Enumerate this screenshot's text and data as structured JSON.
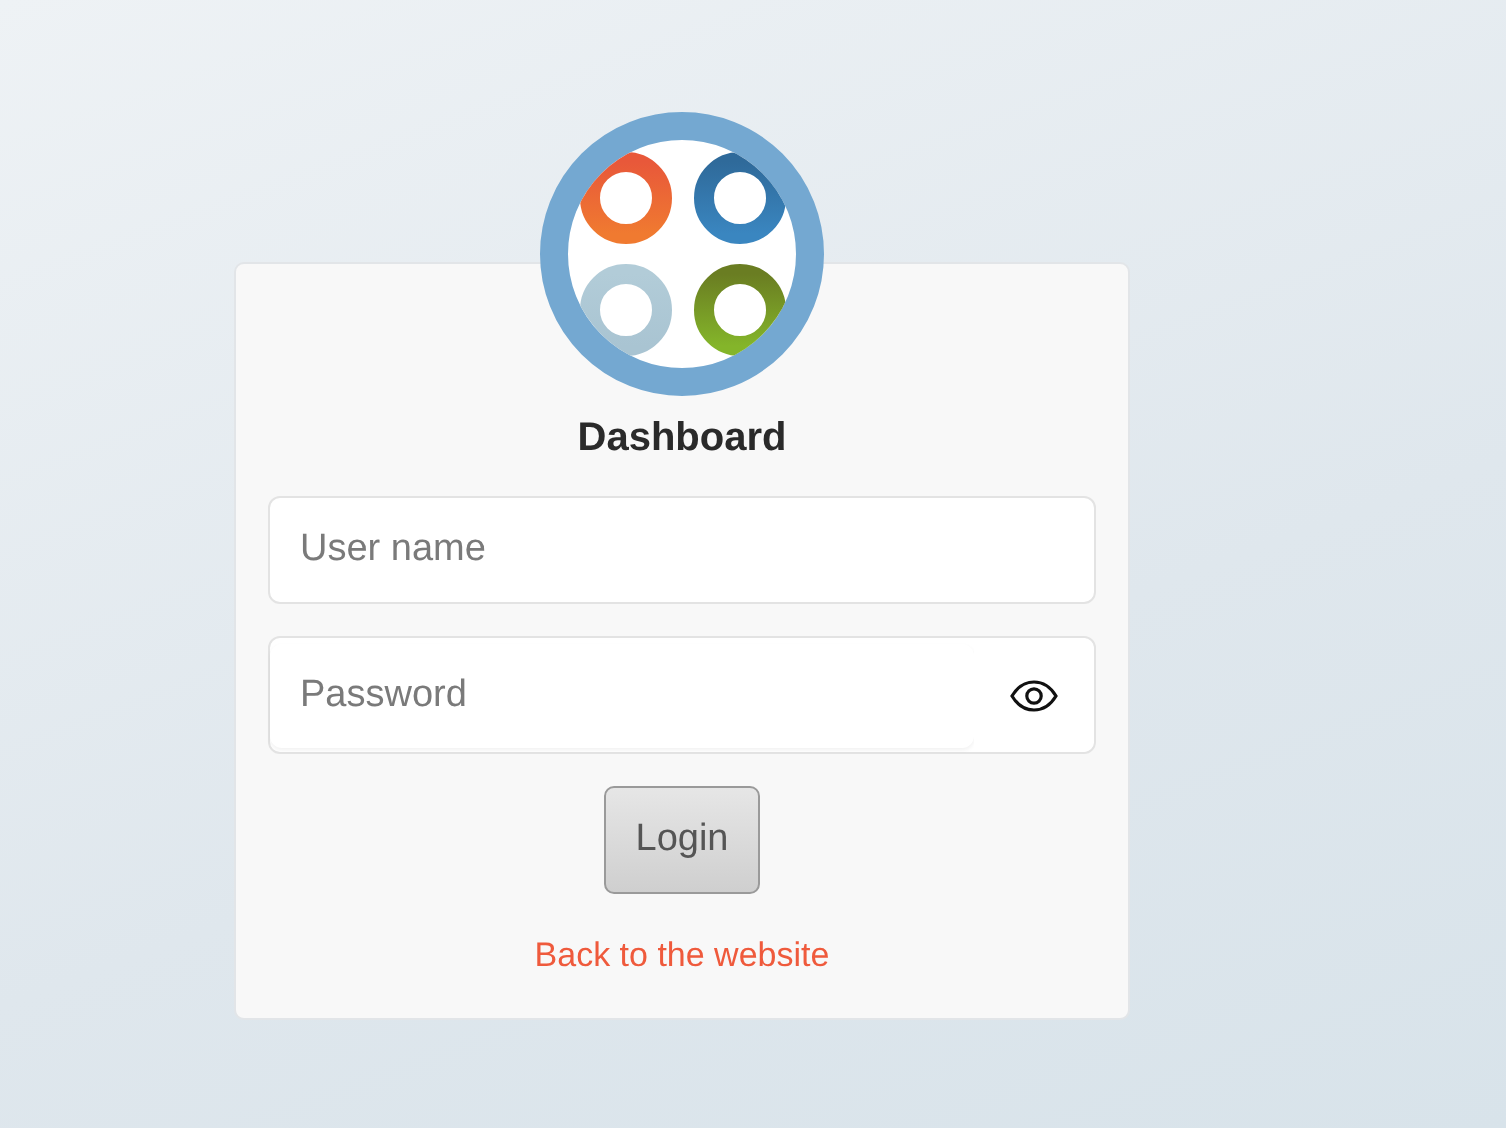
{
  "login_card": {
    "title": "Dashboard",
    "fields": [
      {
        "kind": "text",
        "placeholder": "User name"
      },
      {
        "kind": "password",
        "placeholder": "Password"
      }
    ],
    "submit": {
      "label": "Login"
    },
    "link": {
      "label": "Back to the website"
    }
  }
}
